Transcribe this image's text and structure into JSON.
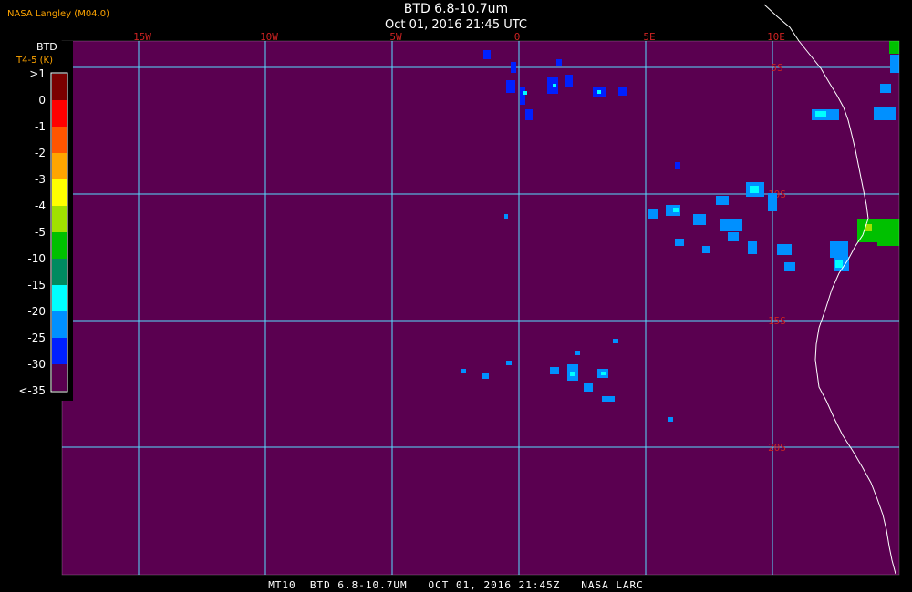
{
  "header": {
    "organization": "NASA Langley (M04.0)",
    "title": "BTD 6.8-10.7um",
    "datetime": "Oct 01, 2016 21:45 UTC"
  },
  "legend": {
    "title": "BTD",
    "unit": "T4-5 (K)",
    "labels": [
      ">1",
      "0",
      "-1",
      "-2",
      "-3",
      "-4",
      "-5",
      "-10",
      "-15",
      "-20",
      "-25",
      "-30",
      "<-35"
    ],
    "colors": [
      "#7a0000",
      "#ff0000",
      "#ff5500",
      "#ffa500",
      "#ffff00",
      "#a0e000",
      "#00c000",
      "#008a60",
      "#00ffff",
      "#0090ff",
      "#0020ff",
      "#5a0050"
    ]
  },
  "map": {
    "background_color": "#5a0050",
    "grid_color": "#55ddff",
    "label_color": "#cc2222",
    "longitude_labels": [
      "15W",
      "10W",
      "5W",
      "0",
      "5E",
      "10E"
    ],
    "latitude_labels": [
      "5S",
      "10S",
      "15S",
      "20S"
    ]
  },
  "footer": {
    "caption": "MT10  BTD 6.8-10.7UM   OCT 01, 2016 21:45Z   NASA LARC"
  }
}
